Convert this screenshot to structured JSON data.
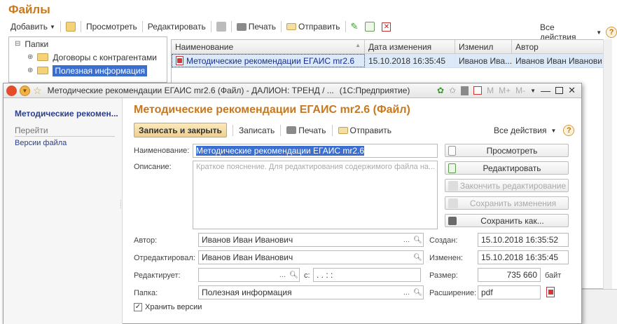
{
  "main": {
    "title": "Файлы",
    "toolbar": {
      "add": "Добавить",
      "view": "Просмотреть",
      "edit": "Редактировать",
      "print": "Печать",
      "send": "Отправить",
      "all_actions": "Все действия"
    },
    "tree": {
      "root": "Папки",
      "items": [
        "Договоры с контрагентами",
        "Полезная информация"
      ]
    },
    "grid": {
      "columns": [
        "Наименование",
        "Дата изменения",
        "Изменил",
        "Автор"
      ],
      "rows": [
        {
          "name": "Методические рекомендации ЕГАИС mr2.6",
          "date": "15.10.2018 16:35:45",
          "changed_by": "Иванов Ива...",
          "author": "Иванов Иван Иванович"
        }
      ]
    }
  },
  "dialog": {
    "window_title": "Методические рекомендации ЕГАИС mr2.6 (Файл) - ДАЛИОН: ТРЕНД / ...",
    "app_name": "(1С:Предприятие)",
    "title_tools": [
      "M",
      "M+",
      "M-"
    ],
    "side": {
      "header": "Методические рекомен...",
      "section": "Перейти",
      "link": "Версии файла"
    },
    "header": "Методические рекомендации ЕГАИС mr2.6 (Файл)",
    "toolbar": {
      "save_close": "Записать и закрыть",
      "save": "Записать",
      "print": "Печать",
      "send": "Отправить",
      "all_actions": "Все действия"
    },
    "fields": {
      "name_label": "Наименование:",
      "name_value": "Методические рекомендации ЕГАИС mr2.6",
      "desc_label": "Описание:",
      "desc_placeholder": "Краткое пояснение. Для редактирования содержимого файла на...",
      "author_label": "Автор:",
      "author_value": "Иванов Иван Иванович",
      "edited_label": "Отредактировал:",
      "edited_value": "Иванов Иван Иванович",
      "editing_label": "Редактирует:",
      "editing_value": "",
      "since_label": "с:",
      "since_value": ". .    :  :",
      "folder_label": "Папка:",
      "folder_value": "Полезная информация",
      "created_label": "Создан:",
      "created_value": "15.10.2018 16:35:52",
      "modified_label": "Изменен:",
      "modified_value": "15.10.2018 16:35:45",
      "size_label": "Размер:",
      "size_value": "735 660",
      "size_unit": "байт",
      "ext_label": "Расширение:",
      "ext_value": "pdf",
      "keep_versions": "Хранить версии"
    },
    "buttons": {
      "view": "Просмотреть",
      "edit": "Редактировать",
      "finish_edit": "Закончить редактирование",
      "save_changes": "Сохранить изменения",
      "save_as": "Сохранить как..."
    }
  },
  "colors": {
    "accent": "#c8781e",
    "link": "#2b3f8c",
    "selection": "#dbe9f8"
  }
}
